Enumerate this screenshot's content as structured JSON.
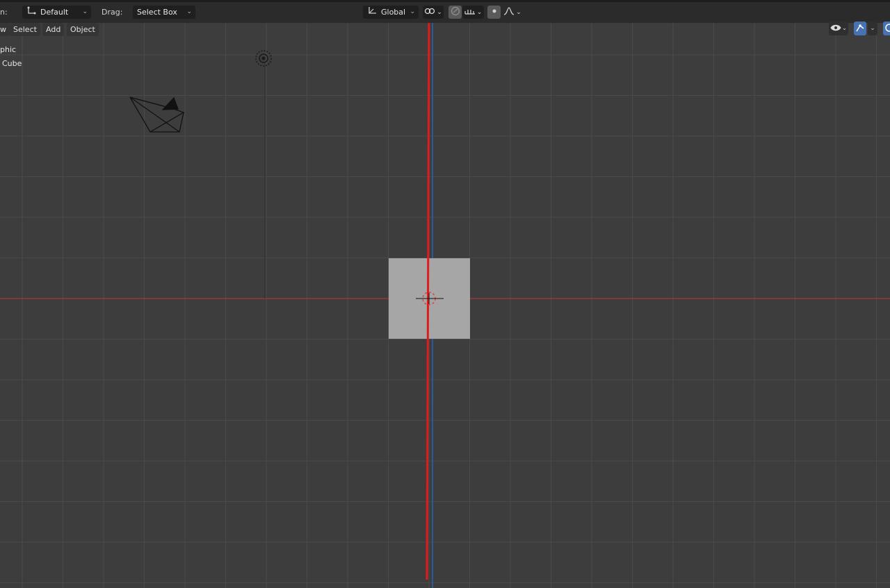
{
  "topbar": {
    "orientation_label_partial": "n:",
    "orientation_value": "Default",
    "drag_label": "Drag:",
    "drag_value": "Select Box",
    "transform_orientation_value": "Global",
    "snap_icon": "link-icon",
    "proportional_icon": "proportional-edit-icon",
    "falloff_icon": "falloff-curve-icon"
  },
  "viewport_menu": {
    "view_partial": "w",
    "select": "Select",
    "add": "Add",
    "object": "Object"
  },
  "overlay": {
    "view_name_partial": "phic",
    "collection_partial": "Cube"
  },
  "header_right": {
    "visibility_icon": "eye-icon",
    "gizmo_icon": "gizmo-icon",
    "overlay_icon": "overlay-icon"
  },
  "colors": {
    "viewport_bg": "#3d3d3d",
    "grid_line": "#4a4a4a",
    "x_axis": "#c83232",
    "z_axis": "#2a5a9a",
    "cube_face": "#a6a6a6",
    "accent_blue": "#4772b3"
  }
}
